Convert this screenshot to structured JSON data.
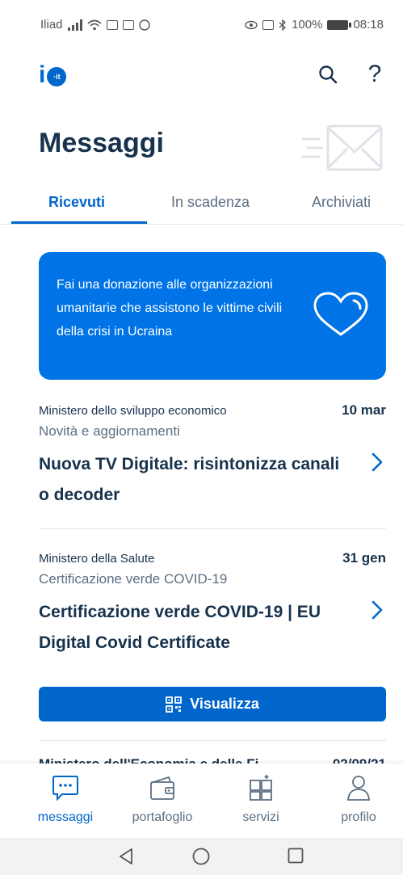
{
  "status_bar": {
    "carrier": "Iliad",
    "battery": "100%",
    "time": "08:18"
  },
  "header": {
    "logo_icon": "io-logo",
    "logo_letter": "i",
    "logo_badge": "·it",
    "search_icon": "search-icon",
    "help_label": "?"
  },
  "page": {
    "title": "Messaggi",
    "title_icon": "envelope-icon"
  },
  "tabs": [
    {
      "label": "Ricevuti",
      "active": true
    },
    {
      "label": "In scadenza",
      "active": false
    },
    {
      "label": "Archiviati",
      "active": false
    }
  ],
  "banner": {
    "text": "Fai una donazione alle organizzazioni umanitarie che assistono le vittime civili della crisi in Ucraina",
    "icon": "heart-icon",
    "color": "#0073e6"
  },
  "messages": [
    {
      "sender": "Ministero dello sviluppo economico",
      "date": "10 mar",
      "service": "Novità e aggiornamenti",
      "title": "Nuova TV Digitale: risintonizza canali o decoder"
    },
    {
      "sender": "Ministero della Salute",
      "date": "31 gen",
      "service": "Certificazione verde COVID-19",
      "title": "Certificazione verde COVID-19 | EU Digital Covid Certificate",
      "action": {
        "label": "Visualizza",
        "icon": "qr-code-icon"
      }
    },
    {
      "sender": "Ministero dell'Economia e delle Fi...",
      "date": "02/09/21"
    }
  ],
  "bottom_nav": [
    {
      "label": "messaggi",
      "icon": "message-bubble-icon",
      "active": true
    },
    {
      "label": "portafoglio",
      "icon": "wallet-icon",
      "active": false
    },
    {
      "label": "servizi",
      "icon": "puzzle-icon",
      "active": false
    },
    {
      "label": "profilo",
      "icon": "user-icon",
      "active": false
    }
  ],
  "colors": {
    "primary": "#0066cc",
    "text": "#17324d",
    "muted": "#5c6f82"
  }
}
